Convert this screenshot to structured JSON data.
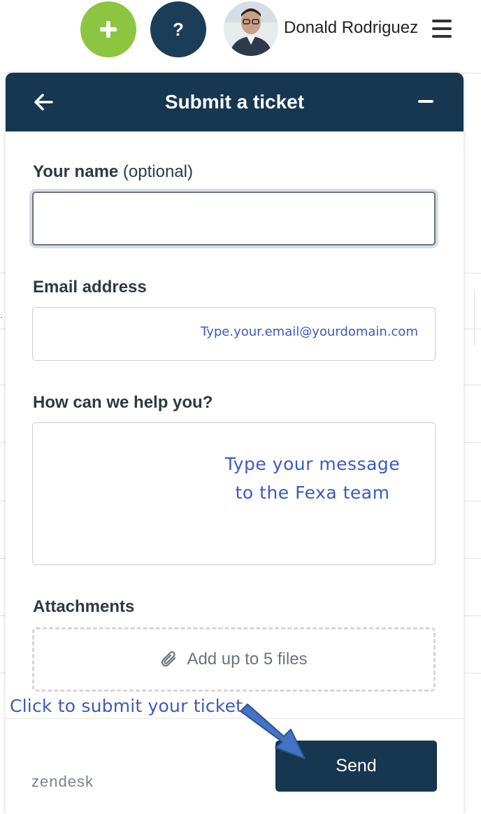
{
  "topbar": {
    "add_symbol": "+",
    "help_symbol": "?",
    "user_name": "Donald Rodriguez"
  },
  "widget": {
    "title": "Submit a ticket",
    "name_label": "Your name",
    "name_label_optional": "(optional)",
    "name_value": "",
    "email_label": "Email address",
    "email_hint": "Type.your.email@yourdomain.com",
    "message_label": "How can we help you?",
    "message_hint_line1": "Type your message",
    "message_hint_line2": "to the Fexa team",
    "attachments_label": "Attachments",
    "attachments_text": "Add up to 5 files",
    "send_label": "Send",
    "brand": "zendesk"
  },
  "annotation": {
    "text": "Click to submit your ticket"
  },
  "colors": {
    "header": "#17364f",
    "add_button": "#8cc640",
    "help_button": "#1b3d58",
    "annotation": "#3a5bbf",
    "arrow": "#4472c4"
  },
  "icons": {
    "back": "arrow-left-icon",
    "minimize": "minus-icon",
    "attach": "paperclip-icon",
    "menu": "hamburger-icon",
    "add": "plus-icon",
    "help": "question-icon"
  }
}
